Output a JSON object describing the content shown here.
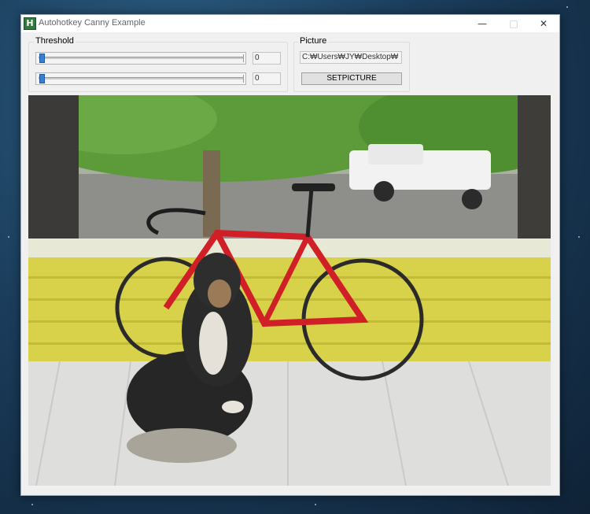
{
  "window": {
    "title": "Autohotkey Canny Example",
    "icon_letter": "H",
    "minimize_icon": "minimize-icon",
    "maximize_icon": "maximize-icon",
    "close_icon": "close-icon"
  },
  "threshold": {
    "label": "Threshold",
    "slider1_value": "0",
    "slider2_value": "0",
    "slider1_level": 0,
    "slider2_level": 0
  },
  "picture": {
    "label": "Picture",
    "path": "C:₩Users₩JY₩Desktop₩",
    "button_label": "SETPICTURE"
  },
  "colors": {
    "slider_thumb": "#3c7fd2",
    "railing_yellow": "#d8d24a",
    "bike_red": "#d11f28"
  }
}
